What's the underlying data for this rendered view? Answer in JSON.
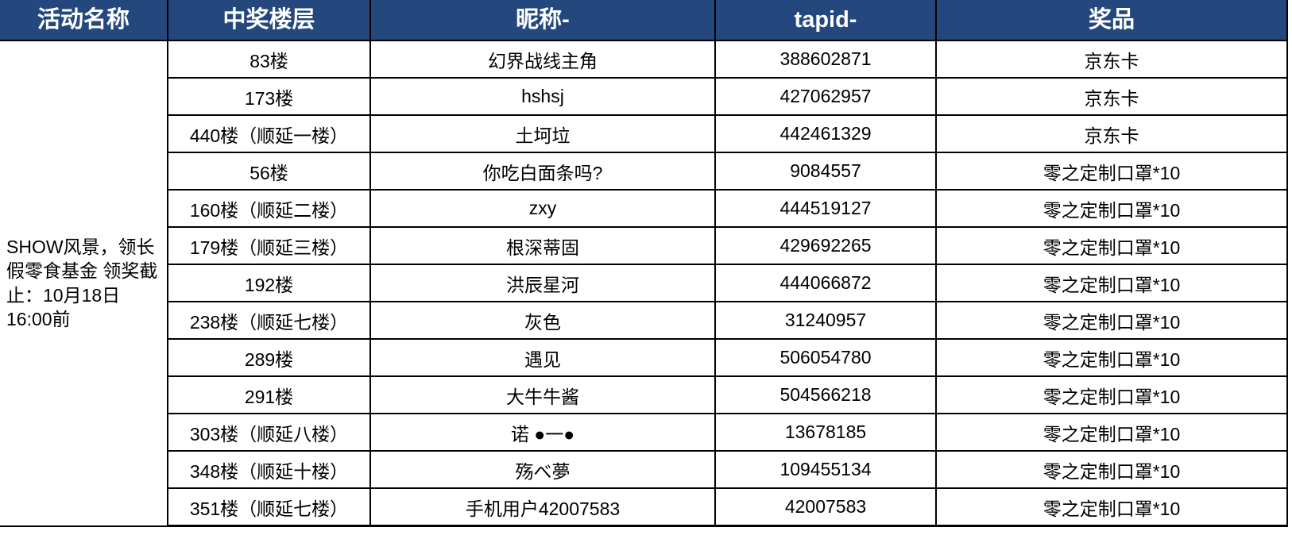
{
  "table": {
    "headers": [
      {
        "label": "活动名称",
        "name": "header-activity-name"
      },
      {
        "label": "中奖楼层",
        "name": "header-winning-floor"
      },
      {
        "label": "昵称-",
        "name": "header-nickname"
      },
      {
        "label": "tapid-",
        "name": "header-tapid"
      },
      {
        "label": "奖品",
        "name": "header-prize"
      }
    ],
    "activity": {
      "text": "SHOW风景，领长假零食基金 领奖截止：10月18日16:00前"
    },
    "rows": [
      {
        "floor": "83楼",
        "nickname": "幻界战线主角",
        "tapid": "388602871",
        "prize": "京东卡"
      },
      {
        "floor": "173楼",
        "nickname": "hshsj",
        "tapid": "427062957",
        "prize": "京东卡"
      },
      {
        "floor": "440楼（顺延一楼）",
        "nickname": "土坷垃",
        "tapid": "442461329",
        "prize": "京东卡"
      },
      {
        "floor": "56楼",
        "nickname": "你吃白面条吗?",
        "tapid": "9084557",
        "prize": "零之定制口罩*10"
      },
      {
        "floor": "160楼（顺延二楼）",
        "nickname": "zxy",
        "tapid": "444519127",
        "prize": "零之定制口罩*10"
      },
      {
        "floor": "179楼（顺延三楼）",
        "nickname": "根深蒂固",
        "tapid": "429692265",
        "prize": "零之定制口罩*10"
      },
      {
        "floor": "192楼",
        "nickname": "洪辰星河",
        "tapid": "444066872",
        "prize": "零之定制口罩*10"
      },
      {
        "floor": "238楼（顺延七楼）",
        "nickname": "灰色",
        "tapid": "31240957",
        "prize": "零之定制口罩*10"
      },
      {
        "floor": "289楼",
        "nickname": "遇见",
        "tapid": "506054780",
        "prize": "零之定制口罩*10"
      },
      {
        "floor": "291楼",
        "nickname": "大牛牛酱",
        "tapid": "504566218",
        "prize": "零之定制口罩*10"
      },
      {
        "floor": "303楼（顺延八楼）",
        "nickname": "诺 ●一●",
        "tapid": "13678185",
        "prize": "零之定制口罩*10"
      },
      {
        "floor": "348楼（顺延十楼）",
        "nickname": "殇べ夢",
        "tapid": "109455134",
        "prize": "零之定制口罩*10"
      },
      {
        "floor": "351楼（顺延七楼）",
        "nickname": "手机用户42007583",
        "tapid": "42007583",
        "prize": "零之定制口罩*10"
      }
    ]
  },
  "colors": {
    "header_background": "#24487d",
    "header_text": "#ffffff",
    "border": "#000000",
    "cell_background": "#ffffff",
    "cell_text": "#000000"
  }
}
